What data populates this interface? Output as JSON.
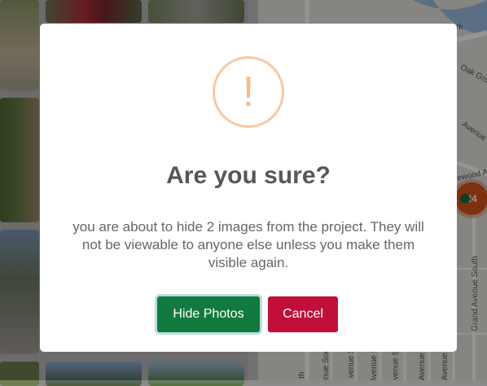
{
  "dialog": {
    "icon": "exclamation-icon",
    "icon_glyph": "!",
    "title": "Are you sure?",
    "message": "you are about to hide 2 images from the project. They will not be viewable to anyone else unless you make them visible again.",
    "confirm_label": "Hide Photos",
    "cancel_label": "Cancel"
  },
  "map": {
    "labels": [
      "rk",
      "Oak Grove",
      "Avenue",
      "ewood A",
      "Grand Avenue South",
      "th",
      "enue South",
      "venue S",
      "Avenue So",
      "venue So",
      "Avenue S",
      "Avenue S"
    ],
    "cluster_count": "24"
  },
  "colors": {
    "confirm": "#127a3e",
    "cancel": "#c0103a",
    "warning": "#f8bb86",
    "cluster": "#d9531e"
  }
}
